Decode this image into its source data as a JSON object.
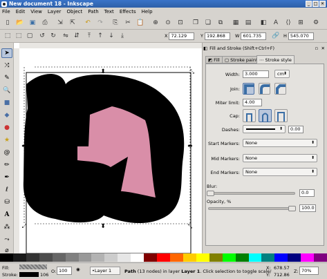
{
  "window": {
    "title": "New document 18 - Inkscape",
    "min": "_",
    "max": "□",
    "close": "✕"
  },
  "menu": [
    "File",
    "Edit",
    "View",
    "Layer",
    "Object",
    "Path",
    "Text",
    "Effects",
    "Help"
  ],
  "coords": {
    "x_label": "X",
    "x": "72.129",
    "y_label": "Y",
    "y": "192.868",
    "w_label": "W",
    "w": "601.735",
    "h_label": "H",
    "h": "545.070"
  },
  "panel": {
    "title": "Fill and Stroke (Shift+Ctrl+F)",
    "tabs": [
      "Fill",
      "Stroke paint",
      "Stroke style"
    ],
    "width_label": "Width:",
    "width_value": "3.000",
    "width_unit": "cm",
    "join_label": "Join:",
    "miter_label": "Miter limit:",
    "miter_value": "4.00",
    "cap_label": "Cap:",
    "dashes_label": "Dashes:",
    "dashes_value": "0.00",
    "start_markers_label": "Start Markers:",
    "start_markers_value": "None",
    "mid_markers_label": "Mid Markers:",
    "mid_markers_value": "None",
    "end_markers_label": "End Markers:",
    "end_markers_value": "None",
    "blur_label": "Blur:",
    "blur_value": "0.0",
    "blur_level": 0,
    "opacity_label": "Opacity, %",
    "opacity_value": "100.0",
    "opacity_level": 100
  },
  "shape": {
    "fill": "#d98ea8",
    "stroke": "#000000"
  },
  "palette": [
    "#000000",
    "#1a1a1a",
    "#333333",
    "#4d4d4d",
    "#666666",
    "#808080",
    "#999999",
    "#b3b3b3",
    "#cccccc",
    "#e6e6e6",
    "#ffffff",
    "#800000",
    "#ff0000",
    "#ff6600",
    "#ffcc00",
    "#ffff00",
    "#808000",
    "#00ff00",
    "#008000",
    "#00ffff",
    "#008080",
    "#0000ff",
    "#000080",
    "#ff00ff",
    "#800080"
  ],
  "status": {
    "fill_label": "Fill:",
    "stroke_label": "Stroke:",
    "stroke_width": "106",
    "opacity_label": "O:",
    "opacity_value": "100",
    "layer": "•Layer 1",
    "message_prefix": "Path",
    "message_nodes": "(13 nodes) in layer",
    "message_layer": "Layer 1",
    "message_suffix": ". Click selection to toggle scale/",
    "x_label": "X:",
    "x_value": "678.57",
    "y_label": "Y:",
    "y_value": "712.86",
    "zoom_label": "Z:",
    "zoom_value": "70%"
  }
}
